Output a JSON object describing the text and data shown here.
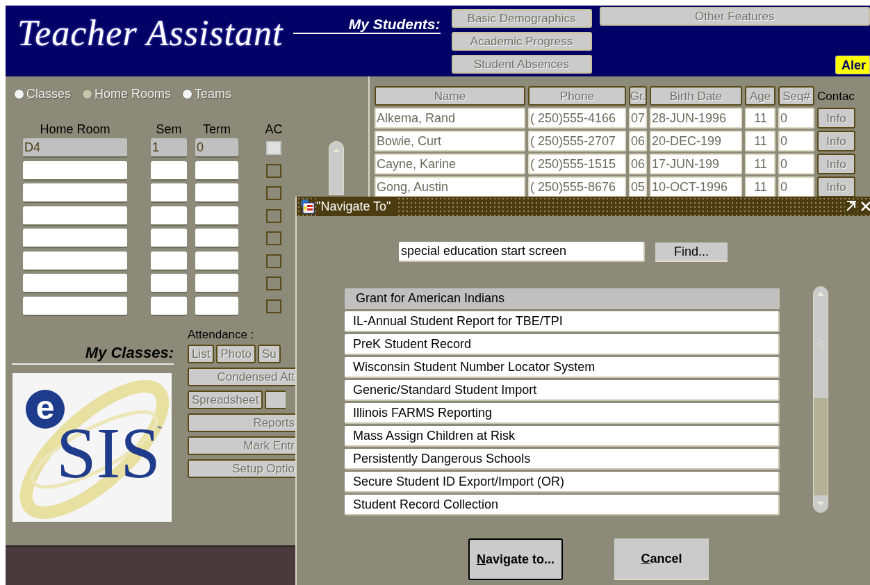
{
  "app": {
    "title": "Teacher Assistant",
    "my_students_label": "My Students:",
    "student_buttons": [
      "Basic Demographics",
      "Academic Progress",
      "Student Absences"
    ],
    "other_features": "Other Features",
    "alert_button": "Aler"
  },
  "view_options": [
    {
      "label": "Classes",
      "selected": false,
      "underline_first": true
    },
    {
      "label": "Home Rooms",
      "selected": true,
      "underline_first": true
    },
    {
      "label": "Teams",
      "selected": false,
      "underline_first": true
    }
  ],
  "home_rooms": {
    "columns": [
      "Home Room",
      "Sem",
      "Term",
      "AC"
    ],
    "rows": [
      {
        "home_room": "D4",
        "sem": "1",
        "term": "0",
        "selected": true,
        "checked": false
      },
      {
        "selected": false,
        "checked": false
      },
      {
        "selected": false,
        "checked": false
      },
      {
        "selected": false,
        "checked": false
      },
      {
        "selected": false,
        "checked": false
      },
      {
        "selected": false,
        "checked": false
      },
      {
        "selected": false,
        "checked": false
      },
      {
        "selected": false,
        "checked": false
      }
    ]
  },
  "my_classes_label": "My Classes:",
  "logo": {
    "mark": "e",
    "name": "SIS",
    "tm": "™"
  },
  "attendance": {
    "label": "Attendance :",
    "button_rows": [
      {
        "buttons": [
          "List",
          "Photo",
          "Su"
        ]
      },
      {
        "buttons": [
          "Condensed Att"
        ]
      },
      {
        "buttons": [
          "Spreadsheet"
        ],
        "cut_button": true
      },
      {
        "buttons": [
          "Reports"
        ]
      },
      {
        "buttons": [
          "Mark Entr"
        ]
      },
      {
        "buttons": [
          "Setup Optio"
        ]
      }
    ]
  },
  "students": {
    "columns": [
      "Name",
      "Phone",
      "Gr.",
      "Birth Date",
      "Age",
      "Seq#"
    ],
    "contact_label": "Contac",
    "rows": [
      {
        "name": "Alkema, Rand",
        "phone": "( 250)555-4166",
        "grade": "07",
        "birth_date": "28-JUN-1996",
        "age": "11",
        "seq": "0",
        "button": "Info"
      },
      {
        "name": "Bowie, Curt",
        "phone": "( 250)555-2707",
        "grade": "06",
        "birth_date": "20-DEC-199",
        "age": "11",
        "seq": "0",
        "button": "Info"
      },
      {
        "name": "Cayne, Karine",
        "phone": "( 250)555-1515",
        "grade": "06",
        "birth_date": "17-JUN-199",
        "age": "11",
        "seq": "0",
        "button": "Info"
      },
      {
        "name": "Gong, Austin",
        "phone": "( 250)555-8676",
        "grade": "05",
        "birth_date": "10-OCT-1996",
        "age": "11",
        "seq": "0",
        "button": "Info"
      }
    ]
  },
  "dialog": {
    "title": "\"Navigate To\"",
    "search_value": "special education start screen",
    "find_button": "Find...",
    "items": [
      {
        "label": "Grant for American Indians",
        "selected": true
      },
      {
        "label": "IL-Annual Student Report for TBE/TPI",
        "selected": false
      },
      {
        "label": "PreK Student Record",
        "selected": false
      },
      {
        "label": "Wisconsin Student Number Locator System",
        "selected": false
      },
      {
        "label": "Generic/Standard Student Import",
        "selected": false
      },
      {
        "label": "Illinois FARMS Reporting",
        "selected": false
      },
      {
        "label": "Mass Assign Children at Risk",
        "selected": false
      },
      {
        "label": "Persistently Dangerous Schools",
        "selected": false
      },
      {
        "label": "Secure Student ID Export/Import (OR)",
        "selected": false
      },
      {
        "label": "Student Record Collection",
        "selected": false
      }
    ],
    "buttons": [
      {
        "label": "Navigate to...",
        "default": true,
        "underline_first": true
      },
      {
        "label": "Cancel",
        "default": false,
        "underline_first": true
      }
    ]
  }
}
